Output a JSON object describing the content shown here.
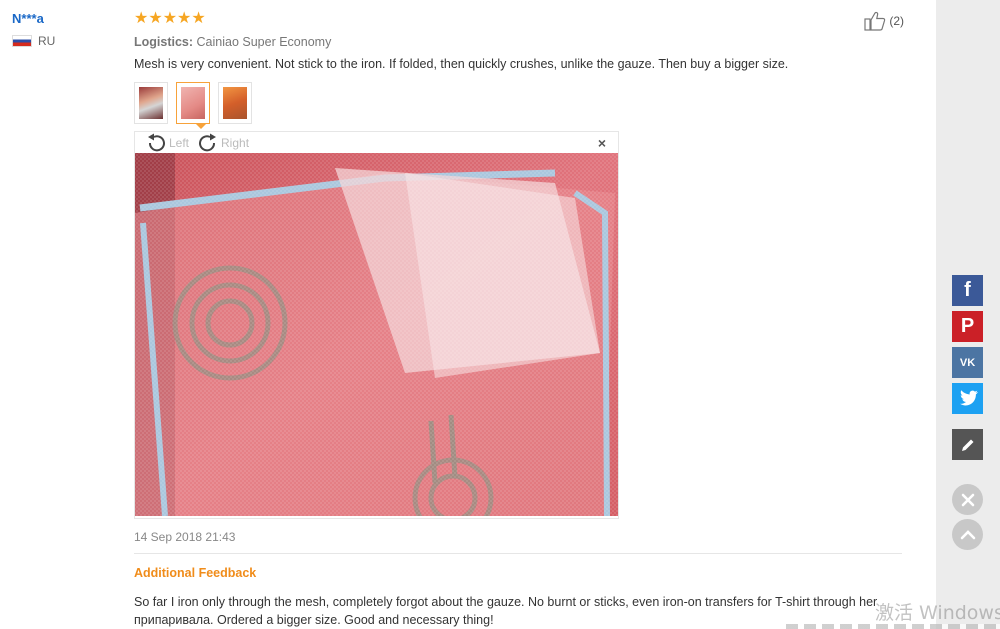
{
  "reviewer": {
    "name": "N***a",
    "country": "RU"
  },
  "review": {
    "stars": "★★★★★",
    "rating": 5,
    "logistics_label": "Logistics:",
    "logistics_value": "Cainiao Super Economy",
    "text": "Mesh is very convenient. Not stick to the iron. If folded, then quickly crushes, unlike the gauze. Then buy a bigger size.",
    "helpful_count": "(2)",
    "thumbnails": [
      "photo-1",
      "photo-2",
      "photo-3"
    ],
    "active_thumbnail": 1,
    "date": "14 Sep 2018 21:43"
  },
  "viewer": {
    "rotate_left_label": "Left",
    "rotate_right_label": "Right",
    "close_label": "×"
  },
  "additional_feedback": {
    "title": "Additional Feedback",
    "text": "So far I iron only through the mesh, completely forgot about the gauze. No burnt or sticks, even iron-on transfers for T-shirt through her припаривала. Ordered a bigger size. Good and necessary thing!"
  },
  "share": {
    "facebook_glyph": "f",
    "pinterest_glyph": "P",
    "vk_glyph": "VK"
  },
  "overlay": {
    "watermark": "激活 Windows"
  },
  "colors": {
    "accent": "#f08c1a",
    "star": "#f6a623",
    "link": "#1a68c7",
    "facebook": "#3b5998",
    "pinterest": "#cb2027",
    "vk": "#4c75a3",
    "twitter": "#1da1f2"
  }
}
